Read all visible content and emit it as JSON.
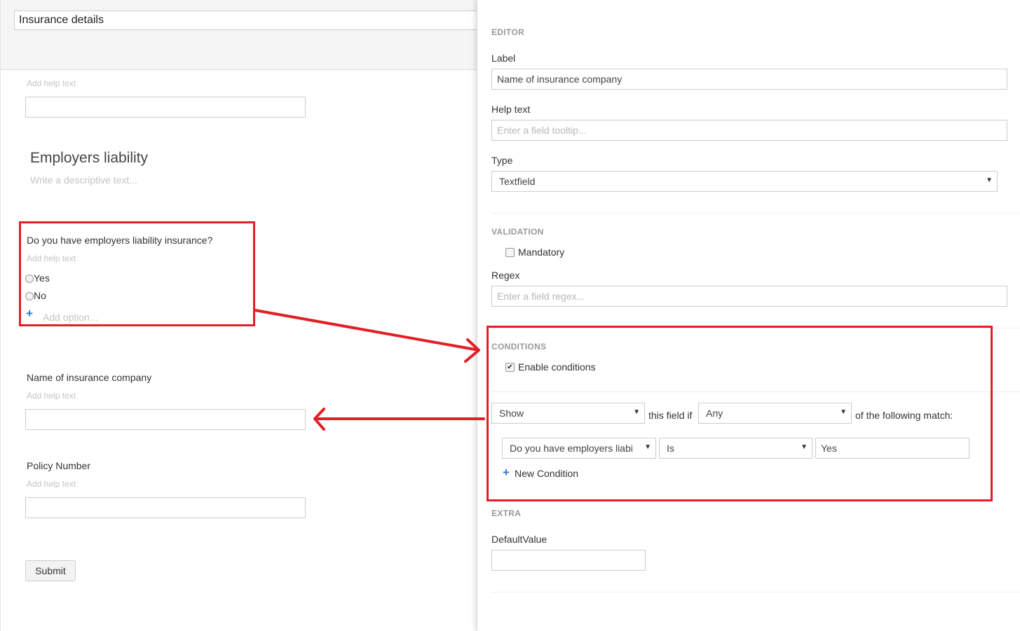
{
  "form": {
    "title": "Insurance details",
    "help_placeholder": "Add help text",
    "section_heading": "Employers liability",
    "section_description_placeholder": "Write a descriptive text...",
    "question": {
      "label": "Do you have employers liability insurance?",
      "options": [
        "Yes",
        "No"
      ],
      "add_option_placeholder": "Add option..."
    },
    "fields": [
      {
        "label": "Name of insurance company"
      },
      {
        "label": "Policy Number"
      }
    ],
    "submit_label": "Submit"
  },
  "editor": {
    "section_title": "EDITOR",
    "label_caption": "Label",
    "label_value": "Name of insurance company",
    "help_caption": "Help text",
    "help_placeholder": "Enter a field tooltip...",
    "type_caption": "Type",
    "type_value": "Textfield"
  },
  "validation": {
    "section_title": "VALIDATION",
    "mandatory_label": "Mandatory",
    "mandatory_checked": false,
    "regex_caption": "Regex",
    "regex_placeholder": "Enter a field regex..."
  },
  "conditions": {
    "section_title": "CONDITIONS",
    "enable_label": "Enable conditions",
    "enable_checked": true,
    "action_value": "Show",
    "middle_text": "this field if",
    "match_value": "Any",
    "trailing_text": "of the following match:",
    "rule": {
      "field": "Do you have employers liabi",
      "operator": "Is",
      "value": "Yes"
    },
    "new_condition_label": "New Condition"
  },
  "extra": {
    "section_title": "EXTRA",
    "default_caption": "DefaultValue",
    "default_value": ""
  },
  "annotation_color": "#e21f26",
  "link_color": "#2a7bd6"
}
